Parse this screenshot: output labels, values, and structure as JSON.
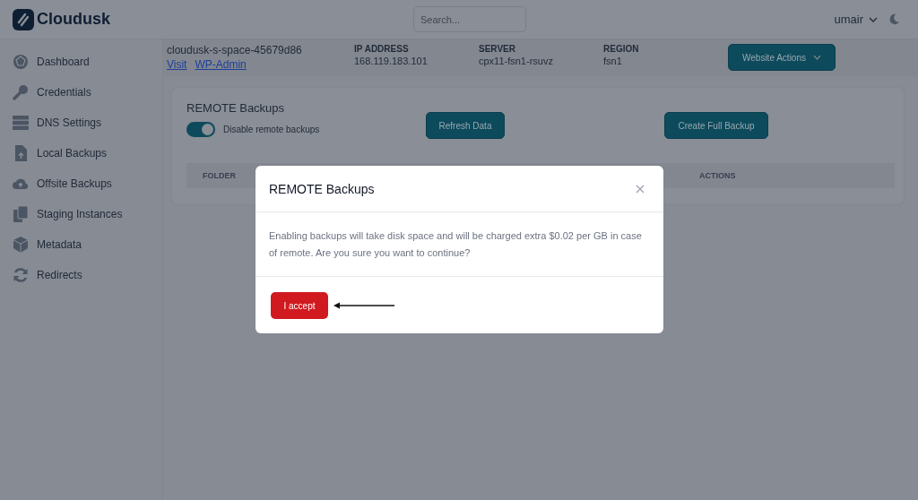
{
  "header": {
    "brand": "Cloudusk",
    "search": {
      "placeholder": "Search..."
    },
    "user": "umair"
  },
  "sidebar": {
    "items": [
      {
        "label": "Dashboard",
        "kind": "dashboard"
      },
      {
        "label": "Credentials",
        "kind": "key"
      },
      {
        "label": "DNS Settings",
        "kind": "server"
      },
      {
        "label": "Local Backups",
        "kind": "file"
      },
      {
        "label": "Offsite Backups",
        "kind": "cloud"
      },
      {
        "label": "Staging Instances",
        "kind": "copy"
      },
      {
        "label": "Metadata",
        "kind": "cube"
      },
      {
        "label": "Redirects",
        "kind": "refresh"
      }
    ]
  },
  "site": {
    "name": "cloudusk-s-space-45679d86",
    "links": [
      "Visit",
      "WP-Admin"
    ],
    "fields": [
      {
        "label": "IP ADDRESS",
        "value": "168.119.183.101"
      },
      {
        "label": "SERVER",
        "value": "cpx11-fsn1-rsuvz"
      },
      {
        "label": "REGION",
        "value": "fsn1"
      }
    ],
    "actions_button": "Website Actions"
  },
  "card": {
    "title": "REMOTE Backups",
    "toggle": {
      "label": "Disable remote backups",
      "on": true
    },
    "buttons": [
      "Refresh Data",
      "Create Full Backup"
    ],
    "table": {
      "columns": [
        "FOLDER",
        "ACTIONS"
      ]
    }
  },
  "modal": {
    "title": "REMOTE Backups",
    "message": "Enabling backups will take disk space and will be charged extra $0.02 per GB in case of remote. Are you sure you want to continue?",
    "button": "I accept"
  }
}
